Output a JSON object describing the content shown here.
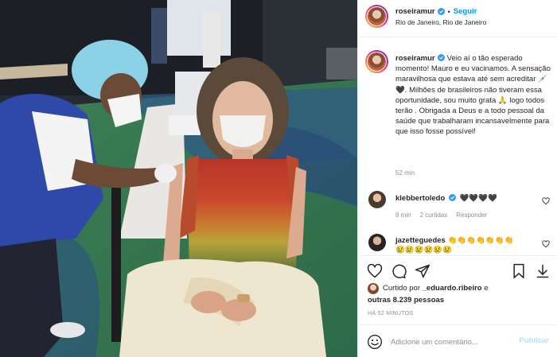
{
  "post": {
    "author": "roseiramur",
    "follow_label": "Seguir",
    "separator": "•",
    "location": "Rio de Janeiro, Rio de Janeiro"
  },
  "caption": {
    "username": "roseiramur",
    "text": "Veio aí o tão esperado momento! Mauro e eu vacinamos. A sensação maravilhosa que estava até sem acreditar 💉 🖤. Milhões de brasileiros não tiveram essa oportunidade, sou muito grata 🙏 logo todos terão . Obrigada a Deus e a todo pessoal da saúde que trabalharam incansavelmente para que isso fosse possível!",
    "time": "52 min"
  },
  "comments": [
    {
      "username": "klebbertoledo",
      "text": "🖤🖤🖤🖤",
      "time": "8 min",
      "likes": "2 curtidas",
      "reply_label": "Responder"
    },
    {
      "username": "jazetteguedes",
      "text": "👏👏👏👏👏👏👏 😢😢😢😢😢😢"
    }
  ],
  "likes": {
    "prefix": "Curtido por",
    "user": "_eduardo.ribeiro",
    "connector": "e",
    "others": "outras 8.239 pessoas"
  },
  "timestamp": "HÁ 52 MINUTOS",
  "add_comment": {
    "placeholder": "Adicione um comentário...",
    "publish_label": "Publicar"
  },
  "colors": {
    "accent": "#0095f6",
    "publish_disabled": "#b2dffc",
    "meta_gray": "#8e8e8e"
  },
  "icons": [
    "heart-icon",
    "comment-icon",
    "share-icon",
    "bookmark-icon",
    "emoji-icon",
    "verified-icon"
  ]
}
